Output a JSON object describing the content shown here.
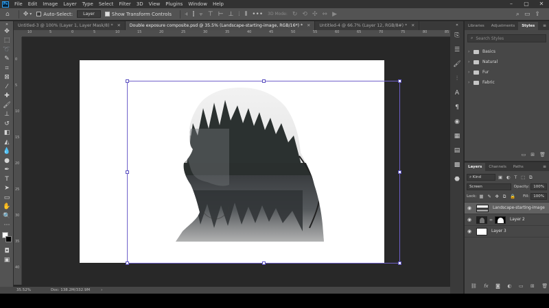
{
  "menubar": {
    "app_logo": "Ps",
    "items": [
      "File",
      "Edit",
      "Image",
      "Layer",
      "Type",
      "Select",
      "Filter",
      "3D",
      "View",
      "Plugins",
      "Window",
      "Help"
    ],
    "window_controls": [
      "–",
      "▢",
      "✕"
    ]
  },
  "options_bar": {
    "auto_select_label": "Auto-Select:",
    "auto_select_value": "Layer",
    "show_transform_label": "Show Transform Controls",
    "more": "•••",
    "mode_3d": "3D Mode:"
  },
  "tabs": [
    {
      "label": "Untitled-3 @ 100% (Layer 1, Layer Mask/8) *",
      "active": false
    },
    {
      "label": "Double exposure composite.psd @ 35.5% (Landscape-starting-image, RGB/16*) *",
      "active": true
    },
    {
      "label": "Untitled-4 @ 66.7% (Layer 12, RGB/8#) *",
      "active": false
    }
  ],
  "ruler": {
    "top_numbers": [
      "10",
      "5",
      "0",
      "5",
      "10",
      "15",
      "20",
      "25",
      "30",
      "35",
      "40",
      "45",
      "50",
      "55",
      "60",
      "65",
      "70",
      "75",
      "80",
      "85"
    ],
    "left_numbers": [
      "0",
      "5",
      "10",
      "15",
      "20",
      "25",
      "30",
      "35",
      "40"
    ]
  },
  "status": {
    "zoom": "35.52%",
    "doc": "Doc: 138.2M/332.9M"
  },
  "styles_panel": {
    "tabs": [
      {
        "label": "Libraries",
        "active": false
      },
      {
        "label": "Adjustments",
        "active": false
      },
      {
        "label": "Styles",
        "active": true
      }
    ],
    "search_placeholder": "Search Styles",
    "folders": [
      "Basics",
      "Natural",
      "Fur",
      "Fabric"
    ]
  },
  "layers_panel": {
    "tabs": [
      {
        "label": "Layers",
        "active": true
      },
      {
        "label": "Channels",
        "active": false
      },
      {
        "label": "Paths",
        "active": false
      }
    ],
    "filter_kind": "Kind",
    "blend_mode": "Screen",
    "opacity_label": "Opacity:",
    "opacity_value": "100%",
    "lock_label": "Lock:",
    "fill_label": "Fill:",
    "fill_value": "100%",
    "layers": [
      {
        "name": "Landscape-starting-image",
        "active": true
      },
      {
        "name": "Layer 2",
        "active": false
      },
      {
        "name": "Layer 3",
        "active": false
      }
    ]
  },
  "colors": {
    "accent": "#31a8ff",
    "transform_box": "#6e5fc9",
    "canvas_bg": "#282828",
    "panel_bg": "#474747"
  }
}
